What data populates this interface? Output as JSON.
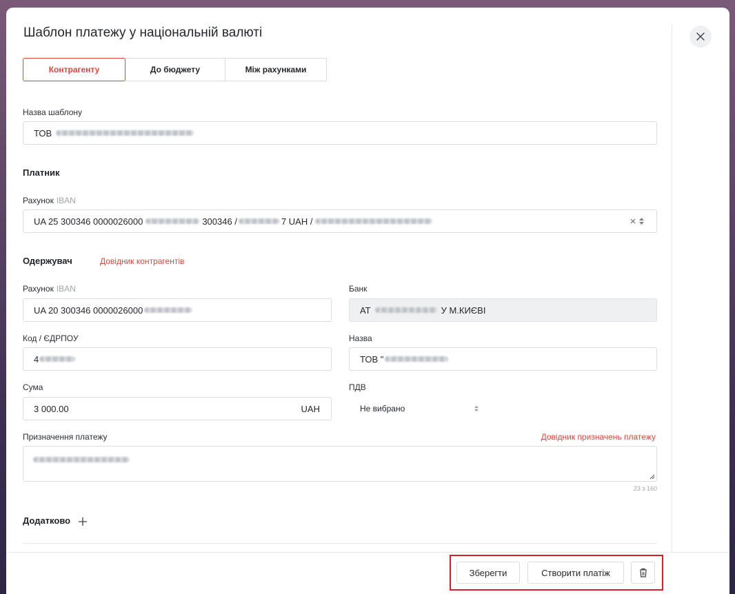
{
  "title": "Шаблон платежу у національній валюті",
  "tabs": [
    {
      "label": "Контрагенту",
      "active": true
    },
    {
      "label": "До бюджету",
      "active": false
    },
    {
      "label": "Між рахунками",
      "active": false
    }
  ],
  "template_name": {
    "label": "Назва шаблону",
    "prefix": "ТОВ"
  },
  "payer": {
    "section": "Платник",
    "account_label": "Рахунок",
    "account_hint": "IBAN",
    "account_part1": "UA 25 300346 0000026000",
    "account_part2": "300346 /",
    "account_part3": "7 UAH /"
  },
  "recipient": {
    "section": "Одержувач",
    "directory_link": "Довідник контрагентів",
    "account_label": "Рахунок",
    "account_hint": "IBAN",
    "account_value": "UA 20 300346 0000026000",
    "bank_label": "Банк",
    "bank_prefix": "АТ",
    "bank_suffix": "У М.КИЄВІ",
    "code_label": "Код / ЄДРПОУ",
    "code_prefix": "4",
    "name_label": "Назва",
    "name_prefix": "ТОВ \""
  },
  "amount": {
    "label": "Сума",
    "value": "3 000.00",
    "currency": "UAH"
  },
  "vat": {
    "label": "ПДВ",
    "value": "Не вибрано"
  },
  "purpose": {
    "label": "Призначення платежу",
    "directory_link": "Довідник призначень платежу",
    "counter": "23 з 160"
  },
  "additional": {
    "label": "Додатково"
  },
  "footer": {
    "save_label": "Зберегти",
    "create_label": "Створити платіж"
  },
  "colors": {
    "accent": "#e0443a",
    "highlight": "#d81f26"
  },
  "icons": {
    "close": "close-icon",
    "clear": "clear-icon",
    "sort": "sort-icon",
    "plus": "plus-icon",
    "trash": "trash-icon",
    "resize": "resize-icon"
  }
}
